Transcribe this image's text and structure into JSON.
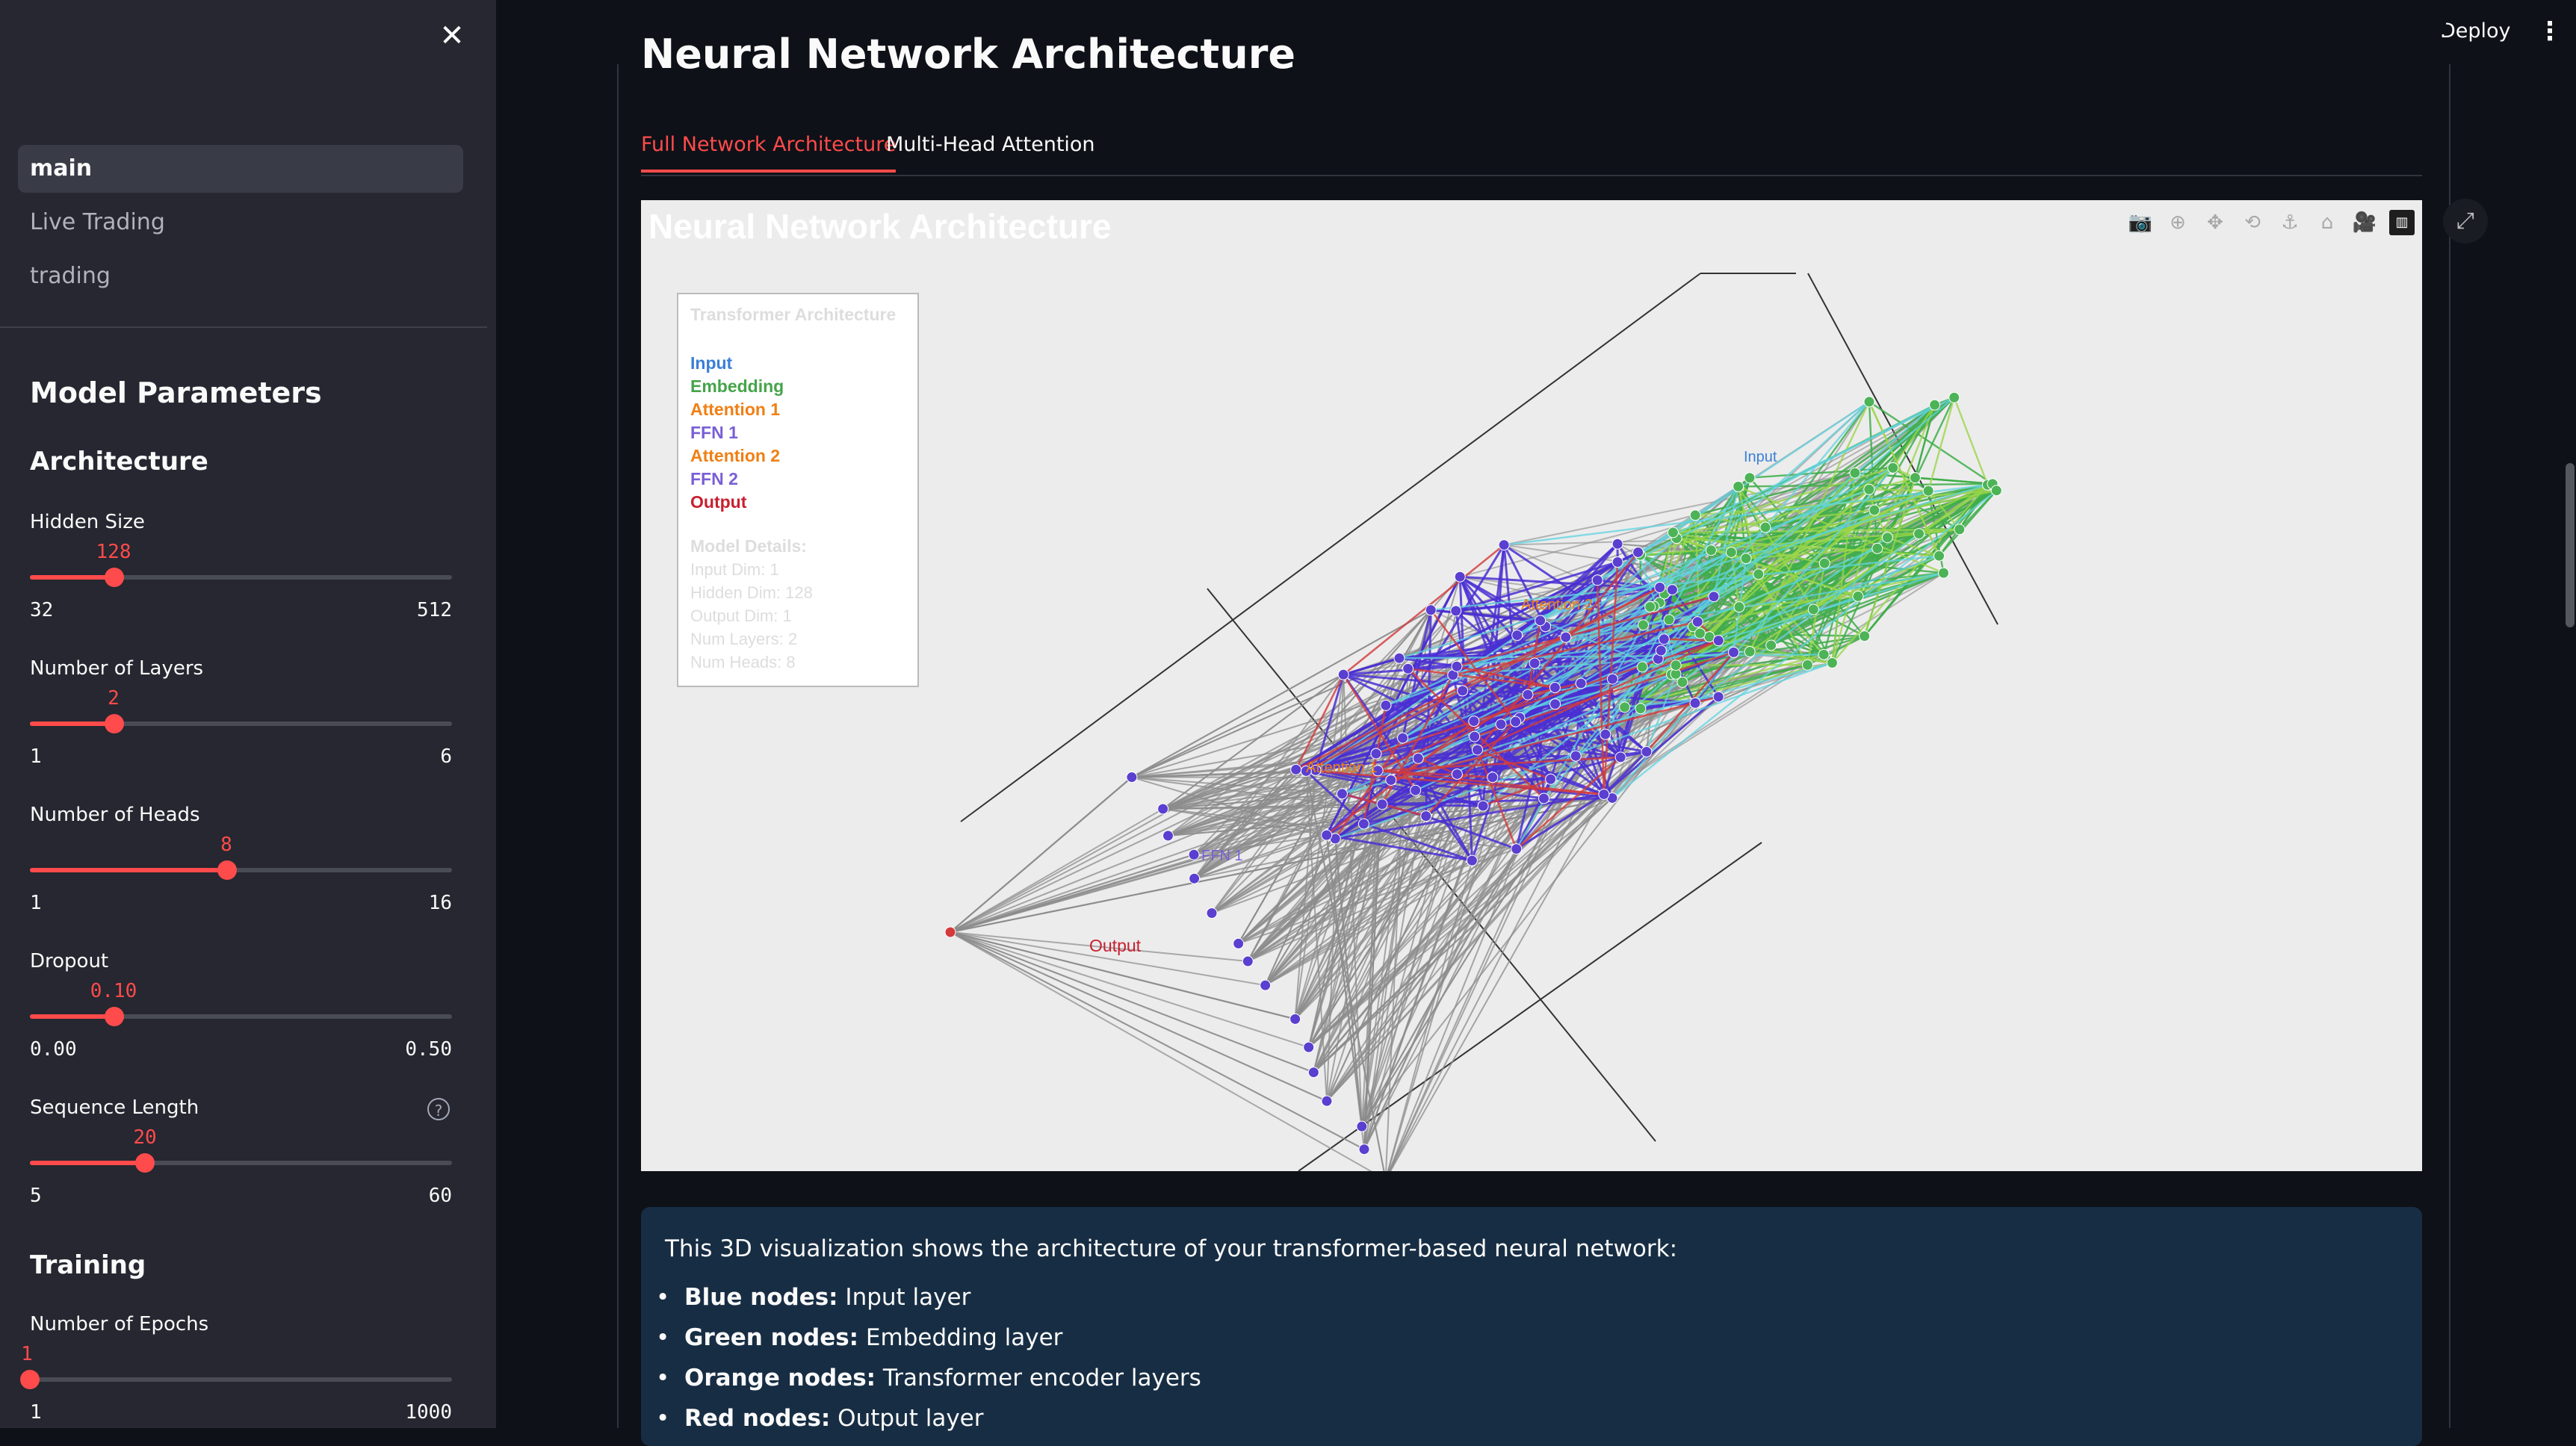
{
  "sidebar": {
    "nav": [
      {
        "label": "main",
        "active": true
      },
      {
        "label": "Live Trading",
        "active": false
      },
      {
        "label": "trading",
        "active": false
      }
    ],
    "model_heading": "Model Parameters",
    "architecture_heading": "Architecture",
    "training_heading": "Training",
    "params": {
      "hidden_size": {
        "label": "Hidden Size",
        "value": "128",
        "min": "32",
        "max": "512",
        "fraction": 0.2
      },
      "num_layers": {
        "label": "Number of Layers",
        "value": "2",
        "min": "1",
        "max": "6",
        "fraction": 0.2
      },
      "num_heads": {
        "label": "Number of Heads",
        "value": "8",
        "min": "1",
        "max": "16",
        "fraction": 0.4667
      },
      "dropout": {
        "label": "Dropout",
        "value": "0.10",
        "min": "0.00",
        "max": "0.50",
        "fraction": 0.2
      },
      "sequence_length": {
        "label": "Sequence Length",
        "value": "20",
        "min": "5",
        "max": "60",
        "fraction": 0.2727
      },
      "num_epochs": {
        "label": "Number of Epochs",
        "value": "1",
        "min": "1",
        "max": "1000",
        "fraction": 0.0
      }
    }
  },
  "header": {
    "deploy": "Deploy"
  },
  "main": {
    "title": "Neural Network Architecture",
    "tabs": [
      {
        "label": "Full Network Architecture",
        "active": true
      },
      {
        "label": "Multi-Head Attention",
        "active": false
      }
    ],
    "plot": {
      "title": "Neural Network Architecture",
      "legend_title": "Transformer Architecture",
      "legend_items": [
        {
          "label": "Input",
          "color": "#3a7fd6"
        },
        {
          "label": "Embedding",
          "color": "#45a44a"
        },
        {
          "label": "Attention 1",
          "color": "#f07f14"
        },
        {
          "label": "FFN 1",
          "color": "#7a5fd6"
        },
        {
          "label": "Attention 2",
          "color": "#f07f14"
        },
        {
          "label": "FFN 2",
          "color": "#7a5fd6"
        },
        {
          "label": "Output",
          "color": "#c8202f"
        }
      ],
      "details_title": "Model Details:",
      "details": [
        "Input Dim: 1",
        "Hidden Dim: 128",
        "Output Dim: 1",
        "Num Layers: 2",
        "Num Heads: 8"
      ],
      "labels": {
        "output": "Output",
        "attention": "Attention 1",
        "ffn": "FFN 1",
        "input": "Input",
        "attention2": "Attention 2"
      }
    },
    "info": {
      "intro": "This 3D visualization shows the architecture of your transformer-based neural network:",
      "items": [
        {
          "bold": "Blue nodes:",
          "text": " Input layer"
        },
        {
          "bold": "Green nodes:",
          "text": " Embedding layer"
        },
        {
          "bold": "Orange nodes:",
          "text": " Transformer encoder layers"
        },
        {
          "bold": "Red nodes:",
          "text": " Output layer"
        }
      ]
    }
  }
}
